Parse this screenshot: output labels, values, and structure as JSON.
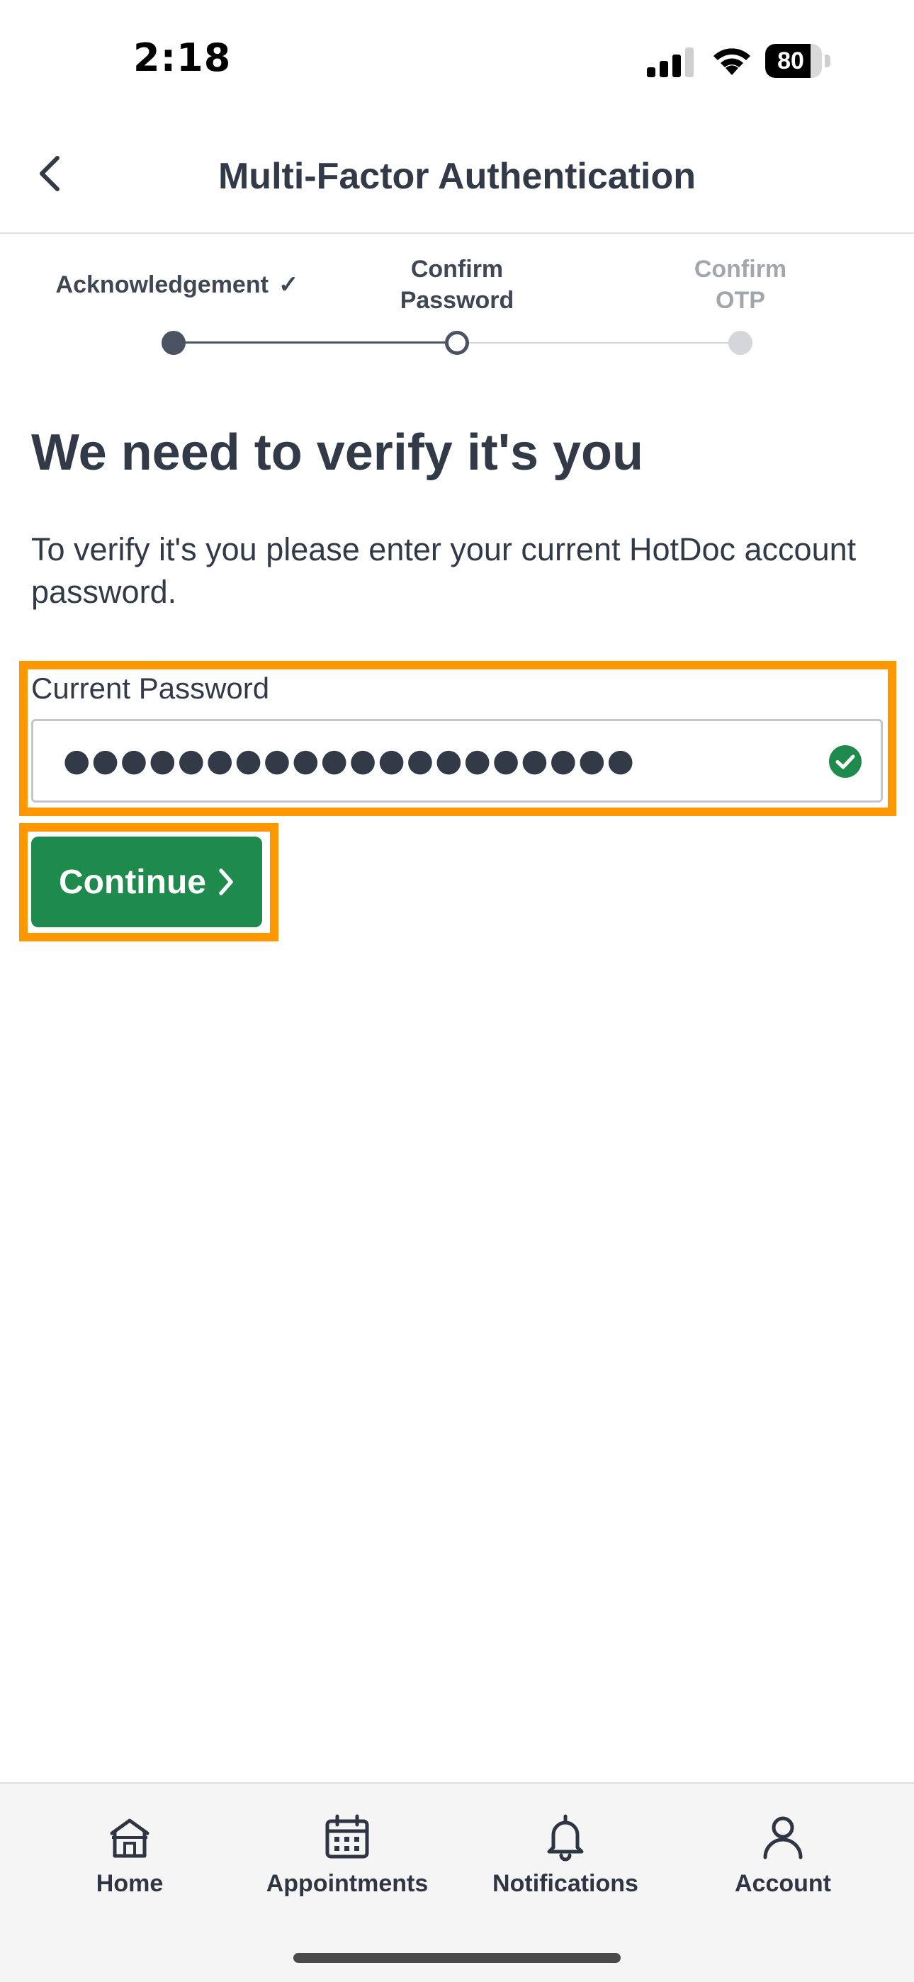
{
  "status_bar": {
    "time": "2:18",
    "battery_percent": 80,
    "battery_label": "80",
    "icons": [
      "signal-icon",
      "wifi-icon",
      "battery-icon"
    ]
  },
  "header": {
    "title": "Multi-Factor Authentication",
    "back_icon": "chevron-left-icon"
  },
  "stepper": {
    "steps": [
      {
        "line1": "Acknowledgement",
        "line2": "",
        "status": "complete",
        "check": "✓"
      },
      {
        "line1": "Confirm",
        "line2": "Password",
        "status": "current"
      },
      {
        "line1": "Confirm",
        "line2": "OTP",
        "status": "upcoming"
      }
    ]
  },
  "main": {
    "heading": "We need to verify it's you",
    "description": "To verify it's you please enter your current HotDoc account password.",
    "password_field": {
      "label": "Current Password",
      "masked_value": "●●●●●●●●●●●●●●●●●●●●",
      "valid": true,
      "valid_icon": "check-circle-icon"
    },
    "continue_button": {
      "label": "Continue",
      "icon": "chevron-right-icon"
    }
  },
  "tab_bar": {
    "items": [
      {
        "label": "Home",
        "icon": "home-icon"
      },
      {
        "label": "Appointments",
        "icon": "calendar-icon"
      },
      {
        "label": "Notifications",
        "icon": "bell-icon"
      },
      {
        "label": "Account",
        "icon": "person-icon"
      }
    ]
  },
  "colors": {
    "accent_green": "#1e8a4c",
    "highlight_orange": "#ff9800",
    "text_dark": "#323a48",
    "text_muted": "#a2a6ad"
  }
}
